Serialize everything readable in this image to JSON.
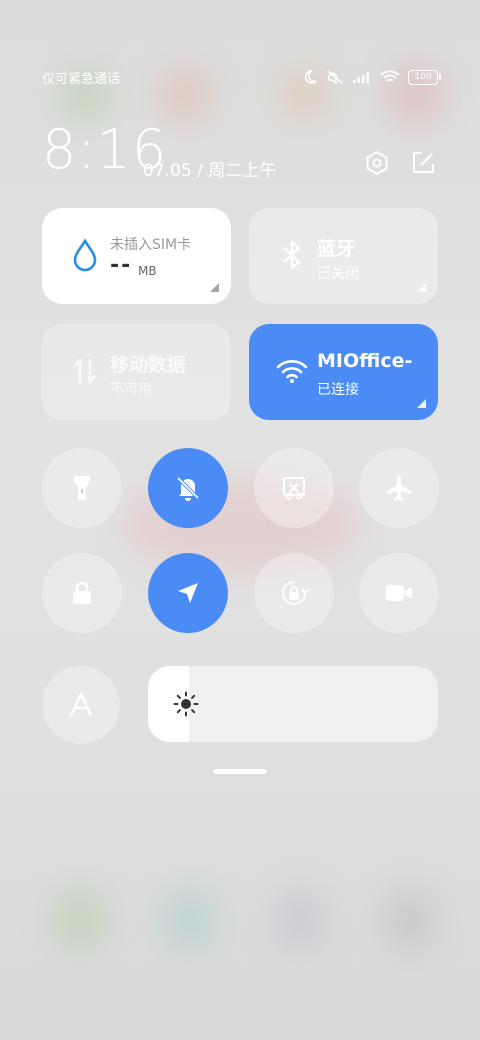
{
  "status_bar": {
    "carrier": "仅可紧急通话",
    "battery": "100",
    "icons": [
      "moon-icon",
      "mute-icon",
      "signal-icon",
      "wifi-icon",
      "battery-icon"
    ]
  },
  "header": {
    "time": "8:16",
    "date": "07.05 / 周二上午",
    "icons": [
      "settings-icon",
      "edit-icon"
    ]
  },
  "tiles": {
    "data_usage": {
      "title": "未插入SIM卡",
      "value": "--",
      "unit": "MB",
      "icon": "water-drop-icon"
    },
    "bluetooth": {
      "title": "蓝牙",
      "status": "已关闭",
      "icon": "bluetooth-icon"
    },
    "mobile_data": {
      "title": "移动数据",
      "status": "不可用",
      "icon": "mobile-data-icon"
    },
    "wifi": {
      "title": "MIOffice-",
      "status": "已连接",
      "icon": "wifi-icon"
    }
  },
  "toggles": [
    {
      "name": "flashlight",
      "icon": "flashlight-icon",
      "active": false
    },
    {
      "name": "mute",
      "icon": "mute-bell-icon",
      "active": true
    },
    {
      "name": "screenshot",
      "icon": "screenshot-icon",
      "active": false
    },
    {
      "name": "airplane",
      "icon": "airplane-icon",
      "active": false
    },
    {
      "name": "lock",
      "icon": "lock-icon",
      "active": false
    },
    {
      "name": "location",
      "icon": "location-arrow-icon",
      "active": true
    },
    {
      "name": "rotation-lock",
      "icon": "rotation-lock-icon",
      "active": false
    },
    {
      "name": "screen-record",
      "icon": "video-camera-icon",
      "active": false
    },
    {
      "name": "font",
      "icon": "font-icon",
      "active": false
    }
  ],
  "brightness": {
    "level": 0.14,
    "icon": "sun-icon"
  },
  "colors": {
    "accent": "#4a8bf5",
    "tile_white": "#ffffff"
  }
}
